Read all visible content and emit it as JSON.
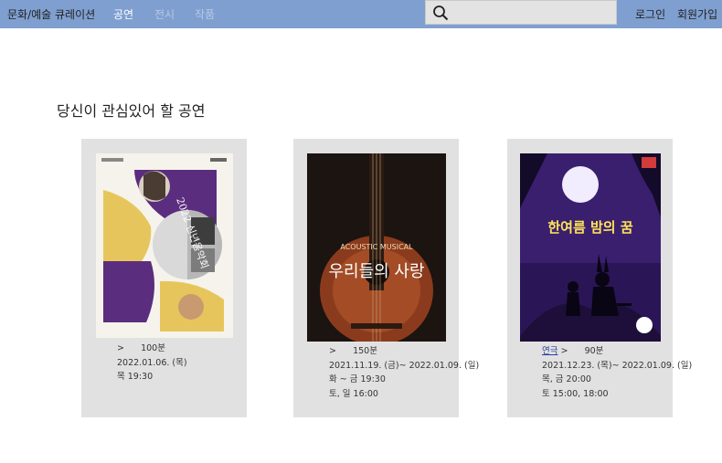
{
  "header": {
    "brand": "문화/예술 큐레이션",
    "nav": [
      {
        "label": "공연",
        "color": "#ffffff"
      },
      {
        "label": "전시",
        "color": "#b8c9e6"
      },
      {
        "label": "작품",
        "color": "#b8c9e6"
      }
    ],
    "search": {
      "placeholder": "",
      "value": "",
      "icon": "search-icon"
    },
    "login": "로그인",
    "signup": "회원가입"
  },
  "section_title": "당신이 관심있어 할 공연",
  "cards": [
    {
      "poster": {
        "title": "2022 신년음악회",
        "colors": {
          "purple": "#5b2d7f",
          "yellow": "#e6c65c",
          "gray": "#b7b7b7"
        }
      },
      "labels": [
        "",
        "",
        "",
        "",
        ""
      ],
      "cat_main": "",
      "cat_sub": "",
      "duration": "100분",
      "date": "2022.01.06. (목)",
      "time1": "목 19:30",
      "time2": "",
      "venue": "",
      "extra": "",
      "extra_muted": ""
    },
    {
      "poster": {
        "title": "우리들의 사랑",
        "subtitle": "ACOUSTIC MUSICAL",
        "colors": {
          "bg": "#1c1410",
          "wood": "#8b3b1d",
          "text": "#ffffff"
        }
      },
      "labels": [
        "",
        "",
        "",
        "",
        ""
      ],
      "cat_main": "",
      "cat_sub": "",
      "duration": "150분",
      "date": "2021.11.19. (금)~ 2022.01.09. (일)",
      "time1": "화 ~ 금 19:30",
      "time2": "토, 일 16:00",
      "venue": "",
      "extra": "",
      "extra_muted": ""
    },
    {
      "poster": {
        "title": "한여름 밤의 꿈",
        "colors": {
          "sky": "#3a1f6e",
          "moon": "#f2ecff",
          "title": "#ffe45a",
          "ground": "#1d0f3a"
        }
      },
      "labels": [
        "",
        "",
        "",
        "",
        ""
      ],
      "cat_main": "연극",
      "cat_sub": "",
      "duration": "90분",
      "date": "2021.12.23. (목)~ 2022.01.09. (일)",
      "time1": "목, 금 20:00",
      "time2": "토 15:00, 18:00",
      "venue": "",
      "extra": "",
      "extra_muted": ""
    }
  ]
}
